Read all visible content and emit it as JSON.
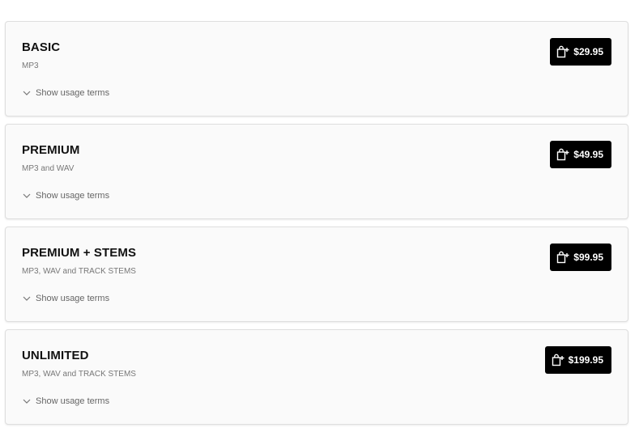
{
  "licenses": [
    {
      "title": "BASIC",
      "formats": "MP3",
      "usage_label": "Show usage terms",
      "price": "$29.95"
    },
    {
      "title": "PREMIUM",
      "formats": "MP3 and WAV",
      "usage_label": "Show usage terms",
      "price": "$49.95"
    },
    {
      "title": "PREMIUM + STEMS",
      "formats": "MP3, WAV and TRACK STEMS",
      "usage_label": "Show usage terms",
      "price": "$99.95"
    },
    {
      "title": "UNLIMITED",
      "formats": "MP3, WAV and TRACK STEMS",
      "usage_label": "Show usage terms",
      "price": "$199.95"
    }
  ],
  "icons": {
    "usage_toggle": "chevron-down-icon",
    "buy": "shopping-bag-add-icon"
  },
  "colors": {
    "button_bg": "#000000",
    "button_text": "#ffffff",
    "card_bg": "#fafafa",
    "title": "#111111",
    "muted": "#777777"
  }
}
